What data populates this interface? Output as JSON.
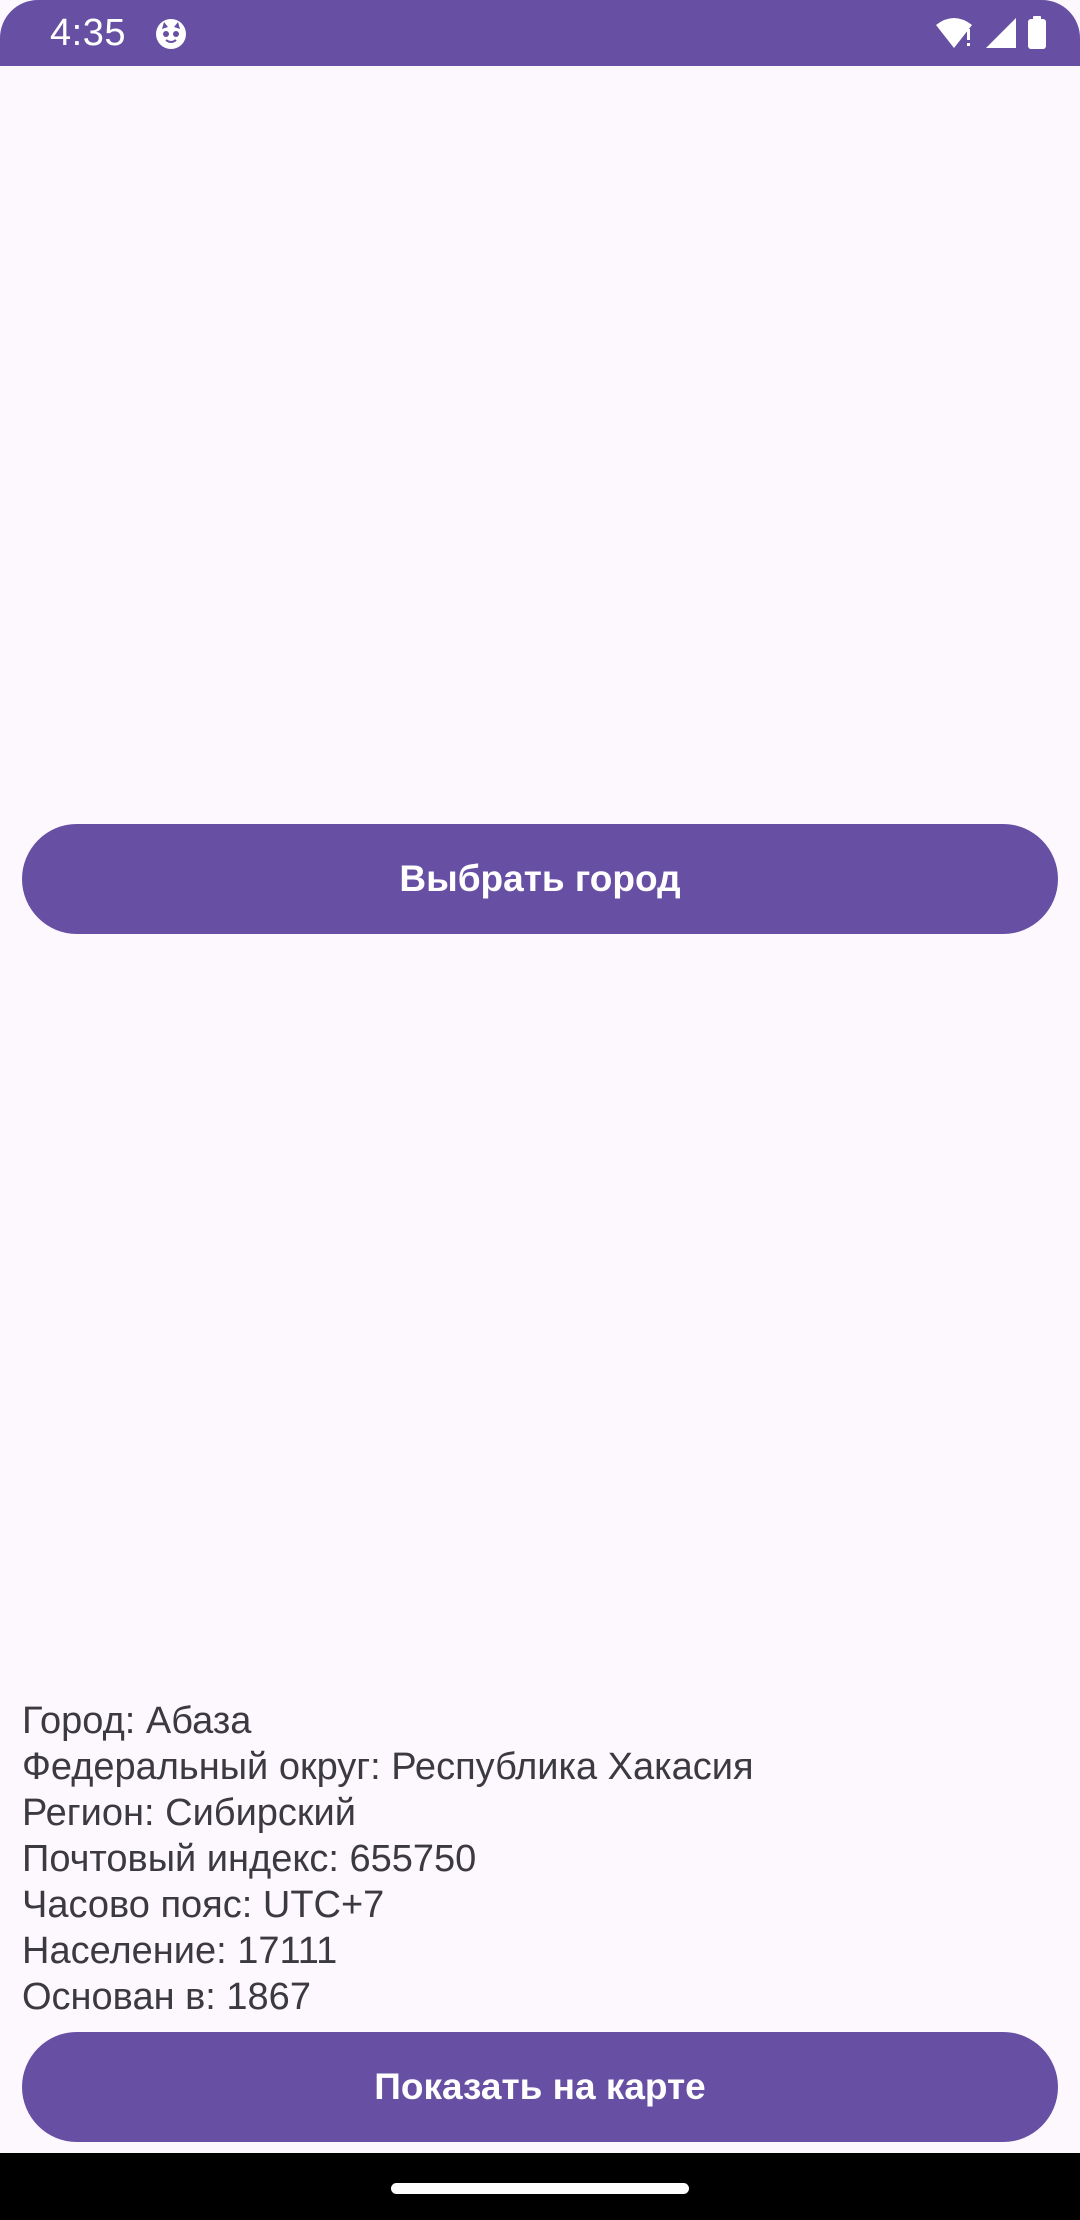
{
  "status_bar": {
    "time": "4:35",
    "app_icon": "cat-face-icon",
    "icons": [
      "wifi-alert-icon",
      "cellular-signal-icon",
      "battery-icon"
    ],
    "background": "#6750a4"
  },
  "main": {
    "choose_city_button": "Выбрать город",
    "city_info": {
      "city": "Город: Абаза",
      "federal_district": "Федеральный округ: Республика Хакасия",
      "region": "Регион: Сибирский",
      "postal_code": "Почтовый индекс: 655750",
      "timezone": "Часово пояс: UTC+7",
      "population": "Население: 17111",
      "founded": "Основан в: 1867"
    },
    "show_on_map_button": "Показать на карте"
  },
  "colors": {
    "accent": "#6750a4",
    "background": "#fdf7fe",
    "text": "#3b3a40",
    "nav_bar": "#000000"
  }
}
